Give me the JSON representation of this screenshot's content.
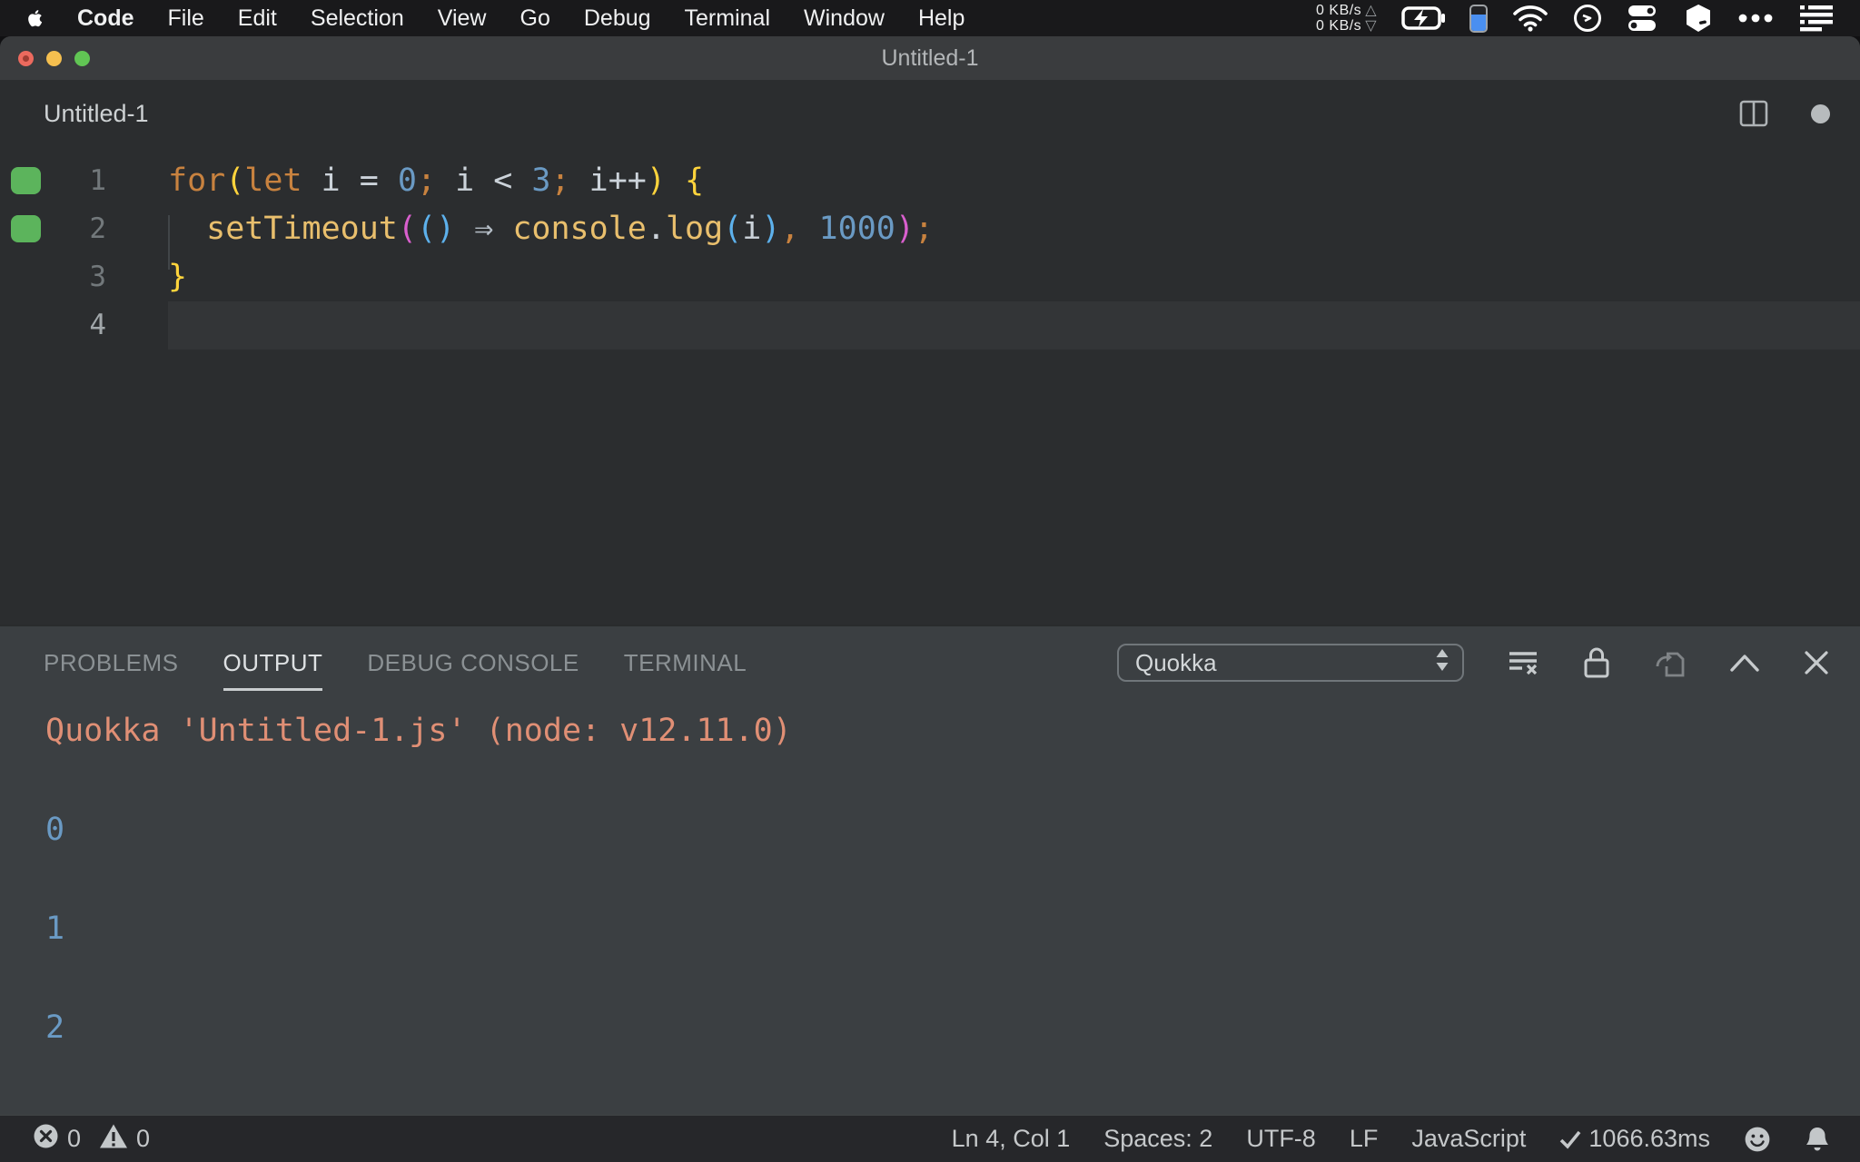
{
  "menu_bar": {
    "items": [
      "Code",
      "File",
      "Edit",
      "Selection",
      "View",
      "Go",
      "Debug",
      "Terminal",
      "Window",
      "Help"
    ],
    "status": {
      "net_up": "0 KB/s",
      "net_down": "0 KB/s",
      "up_glyph": "△",
      "down_glyph": "▽"
    },
    "status_icons": [
      "network-speed",
      "battery-charging",
      "battery-level",
      "wifi",
      "clock",
      "toggles",
      "cube",
      "more-dots",
      "list-menu"
    ]
  },
  "window": {
    "title": "Untitled-1",
    "tab_title": "Untitled-1"
  },
  "editor": {
    "lines": [
      {
        "number": "1",
        "marker": true,
        "active": false,
        "tokens": [
          {
            "t": "for",
            "c": "kw"
          },
          {
            "t": "(",
            "c": "b1"
          },
          {
            "t": "let",
            "c": "kw"
          },
          {
            "t": " i ",
            "c": "id"
          },
          {
            "t": "=",
            "c": "op"
          },
          {
            "t": " ",
            "c": "id"
          },
          {
            "t": "0",
            "c": "num"
          },
          {
            "t": ";",
            "c": "kw"
          },
          {
            "t": " i ",
            "c": "id"
          },
          {
            "t": "<",
            "c": "op"
          },
          {
            "t": " ",
            "c": "id"
          },
          {
            "t": "3",
            "c": "num"
          },
          {
            "t": ";",
            "c": "kw"
          },
          {
            "t": " i",
            "c": "id"
          },
          {
            "t": "++",
            "c": "op"
          },
          {
            "t": ")",
            "c": "b1"
          },
          {
            "t": " ",
            "c": "id"
          },
          {
            "t": "{",
            "c": "b1"
          }
        ]
      },
      {
        "number": "2",
        "marker": true,
        "active": false,
        "tokens": [
          {
            "t": "  ",
            "c": "id"
          },
          {
            "t": "setTimeout",
            "c": "fn"
          },
          {
            "t": "(",
            "c": "b2"
          },
          {
            "t": "(",
            "c": "b3"
          },
          {
            "t": ")",
            "c": "b3"
          },
          {
            "t": " ",
            "c": "id"
          },
          {
            "t": "⇒",
            "c": "ar"
          },
          {
            "t": " ",
            "c": "id"
          },
          {
            "t": "console",
            "c": "fn"
          },
          {
            "t": ".",
            "c": "op"
          },
          {
            "t": "log",
            "c": "fn"
          },
          {
            "t": "(",
            "c": "b3"
          },
          {
            "t": "i",
            "c": "id"
          },
          {
            "t": ")",
            "c": "b3"
          },
          {
            "t": ",",
            "c": "kw"
          },
          {
            "t": " ",
            "c": "id"
          },
          {
            "t": "1000",
            "c": "num"
          },
          {
            "t": ")",
            "c": "b2"
          },
          {
            "t": ";",
            "c": "kw"
          }
        ]
      },
      {
        "number": "3",
        "marker": false,
        "active": false,
        "tokens": [
          {
            "t": "}",
            "c": "b1"
          }
        ]
      },
      {
        "number": "4",
        "marker": false,
        "active": true,
        "tokens": []
      }
    ]
  },
  "panel": {
    "tabs": [
      "PROBLEMS",
      "OUTPUT",
      "DEBUG CONSOLE",
      "TERMINAL"
    ],
    "active_tab": "OUTPUT",
    "channel": "Quokka",
    "output": [
      {
        "text": "Quokka 'Untitled-1.js' (node: v12.11.0)",
        "tone": "salmon"
      },
      {
        "text": "0",
        "tone": "blue"
      },
      {
        "text": "1",
        "tone": "blue"
      },
      {
        "text": "2",
        "tone": "blue"
      }
    ]
  },
  "status_bar": {
    "errors": "0",
    "warnings": "0",
    "cursor": "Ln 4, Col 1",
    "spaces": "Spaces: 2",
    "encoding": "UTF-8",
    "eol": "LF",
    "language": "JavaScript",
    "quokka_time": "1066.63ms"
  },
  "colors": {
    "keyword_orange": "#c8823f",
    "function_gold": "#e9bf6d",
    "bracket_yellow": "#ffd43c",
    "bracket_pink": "#d95fce",
    "bracket_blue": "#5db1ec",
    "number_blue": "#6a9ac4",
    "output_salmon": "#e08f75",
    "coverage_green": "#5cb45c",
    "traffic_red": "#ec6a5e",
    "traffic_yellow": "#f5bf4f",
    "traffic_green": "#61c554"
  }
}
